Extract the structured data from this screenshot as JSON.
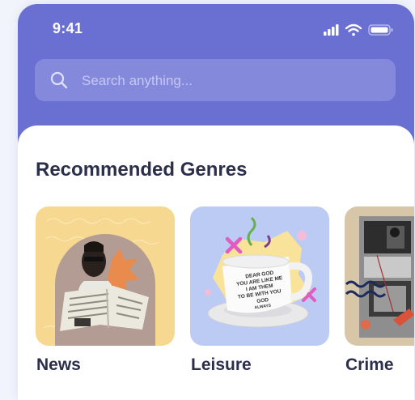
{
  "status_bar": {
    "time": "9:41",
    "icons": [
      "signal-icon",
      "wifi-icon",
      "battery-icon"
    ]
  },
  "search": {
    "placeholder": "Search anything...",
    "value": ""
  },
  "recommended": {
    "title": "Recommended Genres",
    "genres": [
      {
        "label": "News",
        "thumb_color": "#f7d891"
      },
      {
        "label": "Leisure",
        "thumb_color": "#bccbf4"
      },
      {
        "label": "Crime",
        "thumb_color": "#d8c6a8"
      }
    ]
  },
  "colors": {
    "header": "#6a6fd2",
    "search_bg": "#8589dc",
    "title_text": "#2b2f4a",
    "background": "#f1f4fb"
  },
  "mug_text": [
    "DEAR GOD",
    "YOU ARE LIKE ME",
    "I AM THEM",
    "TO BE WITH YOU",
    "GOD",
    "ALWAYS"
  ]
}
